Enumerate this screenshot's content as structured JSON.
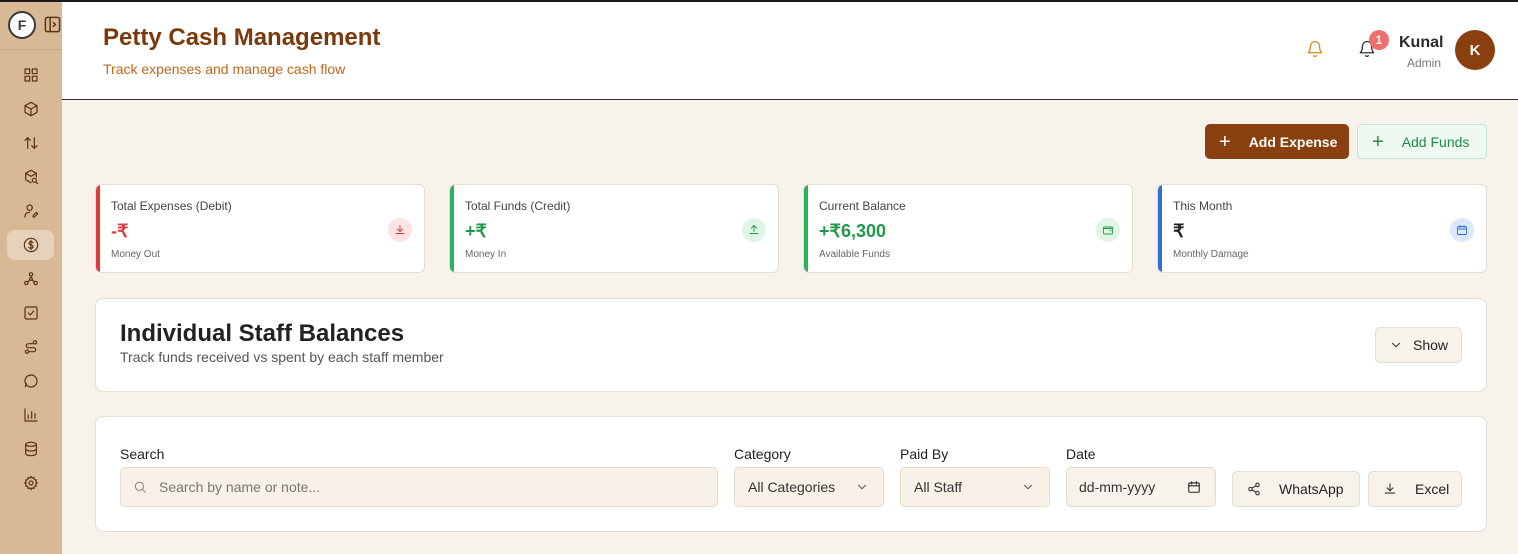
{
  "header": {
    "title": "Petty Cash Management",
    "subtitle": "Track expenses and manage cash flow",
    "notification_count": "1",
    "user_name": "Kunal",
    "user_role": "Admin",
    "avatar_initial": "K"
  },
  "sidebar": {
    "logo_letter": "F",
    "items": [
      {
        "icon": "dashboard-icon"
      },
      {
        "icon": "box-icon"
      },
      {
        "icon": "transfer-icon"
      },
      {
        "icon": "package-search-icon"
      },
      {
        "icon": "user-edit-icon"
      },
      {
        "icon": "dollar-icon",
        "active": true
      },
      {
        "icon": "network-icon"
      },
      {
        "icon": "checkbox-icon"
      },
      {
        "icon": "route-icon"
      },
      {
        "icon": "chat-icon"
      },
      {
        "icon": "bar-chart-icon"
      },
      {
        "icon": "database-icon"
      },
      {
        "icon": "settings-icon"
      }
    ]
  },
  "actions": {
    "add_expense": "Add Expense",
    "add_funds": "Add Funds"
  },
  "cards": [
    {
      "label": "Total Expenses (Debit)",
      "value": "-₹",
      "sub": "Money Out",
      "color": "#dc3b3b",
      "icon": "download-icon"
    },
    {
      "label": "Total Funds (Credit)",
      "value": "+₹",
      "sub": "Money In",
      "color": "#1f9a4a",
      "icon": "upload-icon"
    },
    {
      "label": "Current Balance",
      "value": "+₹6,300",
      "sub": "Available Funds",
      "color": "#1f9a4a",
      "icon": "wallet-icon"
    },
    {
      "label": "This Month",
      "value": "₹",
      "sub": "Monthly Damage",
      "color": "#2f6fd6",
      "icon": "calendar-icon"
    }
  ],
  "staff_balances": {
    "title": "Individual Staff Balances",
    "subtitle": "Track funds received vs spent by each staff member",
    "toggle_label": "Show"
  },
  "filters": {
    "search_label": "Search",
    "search_placeholder": "Search by name or note...",
    "category_label": "Category",
    "category_value": "All Categories",
    "paid_by_label": "Paid By",
    "paid_by_value": "All Staff",
    "date_label": "Date",
    "date_placeholder": "dd-mm-yyyy",
    "whatsapp_label": "WhatsApp",
    "excel_label": "Excel"
  }
}
